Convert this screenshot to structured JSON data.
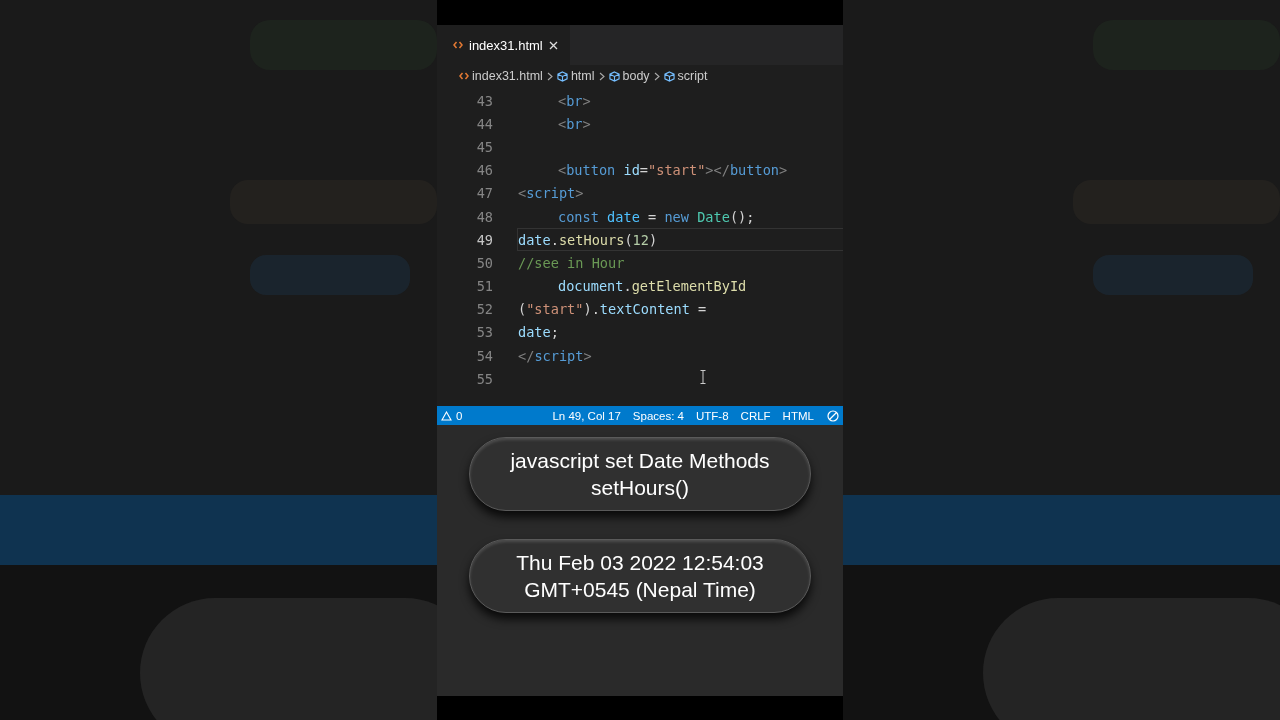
{
  "editor": {
    "tab": {
      "title": "index31.html",
      "selected": true
    },
    "breadcrumbs": [
      {
        "label": "index31.html",
        "kind": "file"
      },
      {
        "label": "html",
        "kind": "symbol"
      },
      {
        "label": "body",
        "kind": "symbol"
      },
      {
        "label": "script",
        "kind": "symbol"
      }
    ],
    "lines": [
      {
        "number": "43",
        "current": false,
        "indented": true,
        "tokens": [
          {
            "t": "<",
            "kind": "punct"
          },
          {
            "t": "br",
            "kind": "tag"
          },
          {
            "t": ">",
            "kind": "punct"
          }
        ]
      },
      {
        "number": "44",
        "current": false,
        "indented": true,
        "tokens": [
          {
            "t": "<",
            "kind": "punct"
          },
          {
            "t": "br",
            "kind": "tag"
          },
          {
            "t": ">",
            "kind": "punct"
          }
        ]
      },
      {
        "number": "45",
        "current": false
      },
      {
        "number": "46",
        "current": false,
        "indented": true,
        "tokens": [
          {
            "t": "<",
            "kind": "punct"
          },
          {
            "t": "button",
            "kind": "tag"
          },
          {
            "t": " id",
            "kind": "attr"
          },
          {
            "t": "=",
            "kind": "plain"
          },
          {
            "t": "\"start\"",
            "kind": "string"
          },
          {
            "t": "></",
            "kind": "punct"
          },
          {
            "t": "button",
            "kind": "tag"
          },
          {
            "t": ">",
            "kind": "punct"
          }
        ]
      },
      {
        "number": "47",
        "current": false,
        "indented": false,
        "tokens": [
          {
            "t": "<",
            "kind": "punct"
          },
          {
            "t": "script",
            "kind": "tag"
          },
          {
            "t": ">",
            "kind": "punct"
          }
        ]
      },
      {
        "number": "48",
        "current": false,
        "indented": true,
        "tokens": [
          {
            "t": "const ",
            "kind": "keyword"
          },
          {
            "t": "date",
            "kind": "const"
          },
          {
            "t": " = ",
            "kind": "plain"
          },
          {
            "t": "new ",
            "kind": "keyword"
          },
          {
            "t": "Date",
            "kind": "class"
          },
          {
            "t": "();",
            "kind": "plain"
          }
        ]
      },
      {
        "number": "49",
        "current": true,
        "indented": false,
        "tokens": [
          {
            "t": "date",
            "kind": "var"
          },
          {
            "t": ".",
            "kind": "plain"
          },
          {
            "t": "setHours",
            "kind": "func"
          },
          {
            "t": "(",
            "kind": "plain"
          },
          {
            "t": "12",
            "kind": "number"
          },
          {
            "t": ")",
            "kind": "plain"
          }
        ]
      },
      {
        "number": "50",
        "current": false,
        "indented": false,
        "tokens": [
          {
            "t": "//see in Hour",
            "kind": "comment"
          }
        ]
      },
      {
        "number": "51",
        "current": false,
        "indented": true,
        "tokens": [
          {
            "t": "document",
            "kind": "var"
          },
          {
            "t": ".",
            "kind": "plain"
          },
          {
            "t": "getElementById",
            "kind": "func"
          }
        ]
      },
      {
        "number": "52",
        "current": false,
        "indented": false,
        "tokens": [
          {
            "t": "(",
            "kind": "plain"
          },
          {
            "t": "\"start\"",
            "kind": "string"
          },
          {
            "t": ").",
            "kind": "plain"
          },
          {
            "t": "textContent",
            "kind": "var"
          },
          {
            "t": " =",
            "kind": "plain"
          }
        ]
      },
      {
        "number": "53",
        "current": false,
        "indented": false,
        "tokens": [
          {
            "t": "date",
            "kind": "var"
          },
          {
            "t": ";",
            "kind": "plain"
          }
        ]
      },
      {
        "number": "54",
        "current": false,
        "indented": false,
        "tokens": [
          {
            "t": "</",
            "kind": "punct"
          },
          {
            "t": "script",
            "kind": "tag"
          },
          {
            "t": ">",
            "kind": "punct"
          }
        ]
      },
      {
        "number": "55",
        "current": false
      }
    ]
  },
  "status_bar": {
    "problems": "0",
    "items": [
      "Ln 49, Col 17",
      "Spaces: 4",
      "UTF-8",
      "CRLF",
      "HTML"
    ]
  },
  "preview": {
    "buttons": [
      {
        "lines": [
          "javascript set Date Methods",
          "setHours()"
        ]
      },
      {
        "lines": [
          "Thu Feb 03 2022 12:54:03",
          "GMT+0545 (Nepal Time)"
        ]
      }
    ]
  }
}
